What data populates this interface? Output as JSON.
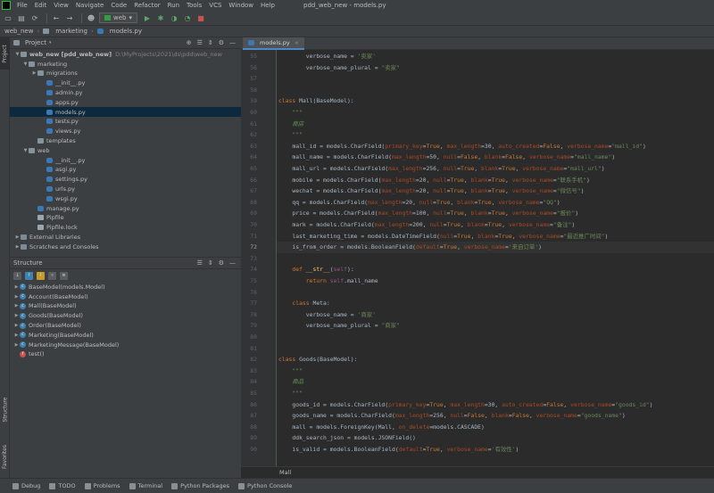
{
  "window_title": "pdd_web_new - models.py",
  "menu": [
    "File",
    "Edit",
    "View",
    "Navigate",
    "Code",
    "Refactor",
    "Run",
    "Tools",
    "VCS",
    "Window",
    "Help"
  ],
  "run_config": "web",
  "breadcrumb": [
    "web_new",
    "marketing",
    "models.py"
  ],
  "left_strip": {
    "project": "Project",
    "structure": "Structure",
    "favorites": "Favorites"
  },
  "project_panel": {
    "title": "Project",
    "tree": [
      {
        "label": "web_new [pdd_web_new]",
        "hint": "D:\\MyProjects\\2021\\ds\\pdd\\web_new",
        "depth": 0,
        "type": "folder",
        "open": true
      },
      {
        "label": "marketing",
        "depth": 1,
        "type": "folder",
        "open": true
      },
      {
        "label": "migrations",
        "depth": 2,
        "type": "folder",
        "open": false
      },
      {
        "label": "__init__.py",
        "depth": 3,
        "type": "py"
      },
      {
        "label": "admin.py",
        "depth": 3,
        "type": "py"
      },
      {
        "label": "apps.py",
        "depth": 3,
        "type": "py"
      },
      {
        "label": "models.py",
        "depth": 3,
        "type": "py",
        "selected": true
      },
      {
        "label": "tests.py",
        "depth": 3,
        "type": "py"
      },
      {
        "label": "views.py",
        "depth": 3,
        "type": "py"
      },
      {
        "label": "templates",
        "depth": 2,
        "type": "folder"
      },
      {
        "label": "web",
        "depth": 1,
        "type": "folder",
        "open": true
      },
      {
        "label": "__init__.py",
        "depth": 3,
        "type": "py"
      },
      {
        "label": "asgi.py",
        "depth": 3,
        "type": "py"
      },
      {
        "label": "settings.py",
        "depth": 3,
        "type": "py"
      },
      {
        "label": "urls.py",
        "depth": 3,
        "type": "py"
      },
      {
        "label": "wsgi.py",
        "depth": 3,
        "type": "py"
      },
      {
        "label": "manage.py",
        "depth": 2,
        "type": "py"
      },
      {
        "label": "Pipfile",
        "depth": 2,
        "type": "txt"
      },
      {
        "label": "Pipfile.lock",
        "depth": 2,
        "type": "txt"
      },
      {
        "label": "External Libraries",
        "depth": 0,
        "type": "lib",
        "open": false
      },
      {
        "label": "Scratches and Consoles",
        "depth": 0,
        "type": "lib",
        "open": false
      }
    ]
  },
  "structure_panel": {
    "title": "Structure",
    "items": [
      {
        "label": "BaseModel(models.Model)",
        "kind": "c"
      },
      {
        "label": "Account(BaseModel)",
        "kind": "c"
      },
      {
        "label": "Mall(BaseModel)",
        "kind": "c"
      },
      {
        "label": "Goods(BaseModel)",
        "kind": "c"
      },
      {
        "label": "Order(BaseModel)",
        "kind": "c"
      },
      {
        "label": "Marketing(BaseModel)",
        "kind": "c"
      },
      {
        "label": "MarketingMessage(BaseModel)",
        "kind": "c"
      },
      {
        "label": "test()",
        "kind": "f"
      }
    ]
  },
  "editor": {
    "tab": "models.py",
    "current_line": 72,
    "breadcrumb": "Mall",
    "lines": [
      {
        "n": 55,
        "t": [
          [
            "",
            "        verbose_name = "
          ],
          [
            "s",
            "'卖家'"
          ]
        ]
      },
      {
        "n": 56,
        "t": [
          [
            "",
            "        verbose_name_plural = "
          ],
          [
            "s",
            "\"卖家\""
          ]
        ]
      },
      {
        "n": 57,
        "t": []
      },
      {
        "n": 58,
        "t": []
      },
      {
        "n": 59,
        "t": [
          [
            "k",
            "class "
          ],
          [
            "",
            "Mall(BaseModel):"
          ]
        ]
      },
      {
        "n": 60,
        "t": [
          [
            "cm",
            "    \"\"\""
          ]
        ]
      },
      {
        "n": 61,
        "t": [
          [
            "cm",
            "    商店"
          ]
        ]
      },
      {
        "n": 62,
        "t": [
          [
            "cm",
            "    \"\"\""
          ]
        ]
      },
      {
        "n": 63,
        "t": [
          [
            "",
            "    mall_id = models.CharField("
          ],
          [
            "kw",
            "primary_key"
          ],
          [
            "",
            "="
          ],
          [
            "k",
            "True"
          ],
          [
            "",
            ", "
          ],
          [
            "kw",
            "max_length"
          ],
          [
            "",
            "=30, "
          ],
          [
            "kw",
            "auto_created"
          ],
          [
            "",
            "="
          ],
          [
            "k",
            "False"
          ],
          [
            "",
            ", "
          ],
          [
            "kw",
            "verbose_name"
          ],
          [
            "",
            "="
          ],
          [
            "s",
            "\"mall_id\""
          ],
          [
            "",
            ")"
          ]
        ]
      },
      {
        "n": 64,
        "t": [
          [
            "",
            "    mall_name = models.CharField("
          ],
          [
            "kw",
            "max_length"
          ],
          [
            "",
            "=50, "
          ],
          [
            "kw",
            "null"
          ],
          [
            "",
            "="
          ],
          [
            "k",
            "False"
          ],
          [
            "",
            ", "
          ],
          [
            "kw",
            "blank"
          ],
          [
            "",
            "="
          ],
          [
            "k",
            "False"
          ],
          [
            "",
            ", "
          ],
          [
            "kw",
            "verbose_name"
          ],
          [
            "",
            "="
          ],
          [
            "s",
            "\"mall_name\""
          ],
          [
            "",
            ")"
          ]
        ]
      },
      {
        "n": 65,
        "t": [
          [
            "",
            "    mall_url = models.CharField("
          ],
          [
            "kw",
            "max_length"
          ],
          [
            "",
            "=256, "
          ],
          [
            "kw",
            "null"
          ],
          [
            "",
            "="
          ],
          [
            "k",
            "True"
          ],
          [
            "",
            ", "
          ],
          [
            "kw",
            "blank"
          ],
          [
            "",
            "="
          ],
          [
            "k",
            "True"
          ],
          [
            "",
            ", "
          ],
          [
            "kw",
            "verbose_name"
          ],
          [
            "",
            "="
          ],
          [
            "s",
            "\"mall_url\""
          ],
          [
            "",
            ")"
          ]
        ]
      },
      {
        "n": 66,
        "t": [
          [
            "",
            "    mobile = models.CharField("
          ],
          [
            "kw",
            "max_length"
          ],
          [
            "",
            "=20, "
          ],
          [
            "kw",
            "null"
          ],
          [
            "",
            "="
          ],
          [
            "k",
            "True"
          ],
          [
            "",
            ", "
          ],
          [
            "kw",
            "blank"
          ],
          [
            "",
            "="
          ],
          [
            "k",
            "True"
          ],
          [
            "",
            ", "
          ],
          [
            "kw",
            "verbose_name"
          ],
          [
            "",
            "="
          ],
          [
            "s",
            "\"联系手机\""
          ],
          [
            "",
            ")"
          ]
        ]
      },
      {
        "n": 67,
        "t": [
          [
            "",
            "    wechat = models.CharField("
          ],
          [
            "kw",
            "max_length"
          ],
          [
            "",
            "=20, "
          ],
          [
            "kw",
            "null"
          ],
          [
            "",
            "="
          ],
          [
            "k",
            "True"
          ],
          [
            "",
            ", "
          ],
          [
            "kw",
            "blank"
          ],
          [
            "",
            "="
          ],
          [
            "k",
            "True"
          ],
          [
            "",
            ", "
          ],
          [
            "kw",
            "verbose_name"
          ],
          [
            "",
            "="
          ],
          [
            "s",
            "\"微信号\""
          ],
          [
            "",
            ")"
          ]
        ]
      },
      {
        "n": 68,
        "t": [
          [
            "",
            "    qq = models.CharField("
          ],
          [
            "kw",
            "max_length"
          ],
          [
            "",
            "=20, "
          ],
          [
            "kw",
            "null"
          ],
          [
            "",
            "="
          ],
          [
            "k",
            "True"
          ],
          [
            "",
            ", "
          ],
          [
            "kw",
            "blank"
          ],
          [
            "",
            "="
          ],
          [
            "k",
            "True"
          ],
          [
            "",
            ", "
          ],
          [
            "kw",
            "verbose_name"
          ],
          [
            "",
            "="
          ],
          [
            "s",
            "\"QQ\""
          ],
          [
            "",
            ")"
          ]
        ]
      },
      {
        "n": 69,
        "t": [
          [
            "",
            "    price = models.CharField("
          ],
          [
            "kw",
            "max_length"
          ],
          [
            "",
            "=100, "
          ],
          [
            "kw",
            "null"
          ],
          [
            "",
            "="
          ],
          [
            "k",
            "True"
          ],
          [
            "",
            ", "
          ],
          [
            "kw",
            "blank"
          ],
          [
            "",
            "="
          ],
          [
            "k",
            "True"
          ],
          [
            "",
            ", "
          ],
          [
            "kw",
            "verbose_name"
          ],
          [
            "",
            "="
          ],
          [
            "s",
            "\"报价\""
          ],
          [
            "",
            ")"
          ]
        ]
      },
      {
        "n": 70,
        "t": [
          [
            "",
            "    mark = models.CharField("
          ],
          [
            "kw",
            "max_length"
          ],
          [
            "",
            "=200, "
          ],
          [
            "kw",
            "null"
          ],
          [
            "",
            "="
          ],
          [
            "k",
            "True"
          ],
          [
            "",
            ", "
          ],
          [
            "kw",
            "blank"
          ],
          [
            "",
            "="
          ],
          [
            "k",
            "True"
          ],
          [
            "",
            ", "
          ],
          [
            "kw",
            "verbose_name"
          ],
          [
            "",
            "="
          ],
          [
            "s",
            "\"备注\""
          ],
          [
            "",
            ")"
          ]
        ]
      },
      {
        "n": 71,
        "t": [
          [
            "",
            "    last_marketing_time = models.DateTimeField("
          ],
          [
            "kw",
            "null"
          ],
          [
            "",
            "="
          ],
          [
            "k",
            "True"
          ],
          [
            "",
            ", "
          ],
          [
            "kw",
            "blank"
          ],
          [
            "",
            "="
          ],
          [
            "k",
            "True"
          ],
          [
            "",
            ", "
          ],
          [
            "kw",
            "verbose_name"
          ],
          [
            "",
            "="
          ],
          [
            "s",
            "\"最近推广时间\""
          ],
          [
            "",
            ")"
          ]
        ]
      },
      {
        "n": 72,
        "t": [
          [
            "",
            "    is_from_order = models.BooleanField("
          ],
          [
            "kw",
            "default"
          ],
          [
            "",
            "="
          ],
          [
            "k",
            "True"
          ],
          [
            "",
            ", "
          ],
          [
            "kw",
            "verbose_name"
          ],
          [
            "",
            "="
          ],
          [
            "s",
            "'来自订单'"
          ],
          [
            "",
            ")"
          ]
        ]
      },
      {
        "n": 73,
        "t": []
      },
      {
        "n": 74,
        "t": [
          [
            "k",
            "    def "
          ],
          [
            "fn",
            "__str__"
          ],
          [
            "",
            "("
          ],
          [
            "sf",
            "self"
          ],
          [
            "",
            "):"
          ]
        ]
      },
      {
        "n": 75,
        "t": [
          [
            "k",
            "        return "
          ],
          [
            "sf",
            "self"
          ],
          [
            "",
            ".mall_name"
          ]
        ]
      },
      {
        "n": 76,
        "t": []
      },
      {
        "n": 77,
        "t": [
          [
            "k",
            "    class "
          ],
          [
            "",
            "Meta:"
          ]
        ]
      },
      {
        "n": 78,
        "t": [
          [
            "",
            "        verbose_name = "
          ],
          [
            "s",
            "'商家'"
          ]
        ]
      },
      {
        "n": 79,
        "t": [
          [
            "",
            "        verbose_name_plural = "
          ],
          [
            "s",
            "\"商家\""
          ]
        ]
      },
      {
        "n": 80,
        "t": []
      },
      {
        "n": 81,
        "t": []
      },
      {
        "n": 82,
        "t": [
          [
            "k",
            "class "
          ],
          [
            "",
            "Goods(BaseModel):"
          ]
        ]
      },
      {
        "n": 83,
        "t": [
          [
            "cm",
            "    \"\"\""
          ]
        ]
      },
      {
        "n": 84,
        "t": [
          [
            "cm",
            "    商品"
          ]
        ]
      },
      {
        "n": 85,
        "t": [
          [
            "cm",
            "    \"\"\""
          ]
        ]
      },
      {
        "n": 86,
        "t": [
          [
            "",
            "    goods_id = models.CharField("
          ],
          [
            "kw",
            "primary_key"
          ],
          [
            "",
            "="
          ],
          [
            "k",
            "True"
          ],
          [
            "",
            ", "
          ],
          [
            "kw",
            "max_length"
          ],
          [
            "",
            "=30, "
          ],
          [
            "kw",
            "auto_created"
          ],
          [
            "",
            "="
          ],
          [
            "k",
            "False"
          ],
          [
            "",
            ", "
          ],
          [
            "kw",
            "verbose_name"
          ],
          [
            "",
            "="
          ],
          [
            "s",
            "\"goods_id\""
          ],
          [
            "",
            ")"
          ]
        ]
      },
      {
        "n": 87,
        "t": [
          [
            "",
            "    goods_name = models.CharField("
          ],
          [
            "kw",
            "max_length"
          ],
          [
            "",
            "=256, "
          ],
          [
            "kw",
            "null"
          ],
          [
            "",
            "="
          ],
          [
            "k",
            "False"
          ],
          [
            "",
            ", "
          ],
          [
            "kw",
            "blank"
          ],
          [
            "",
            "="
          ],
          [
            "k",
            "False"
          ],
          [
            "",
            ", "
          ],
          [
            "kw",
            "verbose_name"
          ],
          [
            "",
            "="
          ],
          [
            "s",
            "\"goods_name\""
          ],
          [
            "",
            ")"
          ]
        ]
      },
      {
        "n": 88,
        "t": [
          [
            "",
            "    mall = models.ForeignKey(Mall, "
          ],
          [
            "kw",
            "on_delete"
          ],
          [
            "",
            "=models.CASCADE)"
          ]
        ]
      },
      {
        "n": 89,
        "t": [
          [
            "",
            "    ddk_search_json = models.JSONField()"
          ]
        ]
      },
      {
        "n": 90,
        "t": [
          [
            "",
            "    is_valid = models.BooleanField("
          ],
          [
            "kw",
            "default"
          ],
          [
            "",
            "="
          ],
          [
            "k",
            "True"
          ],
          [
            "",
            ", "
          ],
          [
            "kw",
            "verbose_name"
          ],
          [
            "",
            "="
          ],
          [
            "s",
            "'有效性'"
          ],
          [
            "",
            ")"
          ]
        ]
      }
    ]
  },
  "bottom_tools": [
    "Debug",
    "TODO",
    "Problems",
    "Terminal",
    "Python Packages",
    "Python Console"
  ]
}
